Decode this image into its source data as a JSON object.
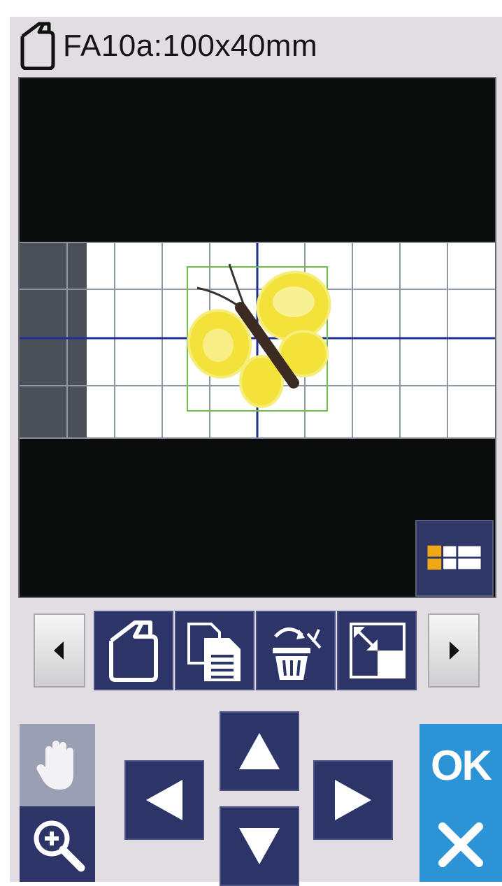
{
  "header": {
    "title": "FA10a:100x40mm",
    "icon": "hoop-icon"
  },
  "preview": {
    "pattern": "butterfly-embroidery",
    "layout_icon": "split-layout-icon"
  },
  "toolbar": {
    "prev_icon": "chevron-left-icon",
    "next_icon": "chevron-right-icon",
    "tools": [
      "hoop-icon",
      "copy-icon",
      "delete-icon",
      "resize-icon"
    ]
  },
  "controls": {
    "hand_icon": "hand-icon",
    "zoom_icon": "zoom-in-icon",
    "arrows": [
      "arrow-up-icon",
      "arrow-left-icon",
      "arrow-right-icon",
      "arrow-down-icon"
    ],
    "ok_label": "OK",
    "cancel_icon": "close-icon"
  },
  "colors": {
    "panel_bg": "#e2dde3",
    "button_navy": "#2c3468",
    "ok_blue": "#2c93d6",
    "pattern_yellow": "#f2e23a",
    "selection_green": "#6cc04a",
    "center_line_blue": "#1e2f9a"
  }
}
